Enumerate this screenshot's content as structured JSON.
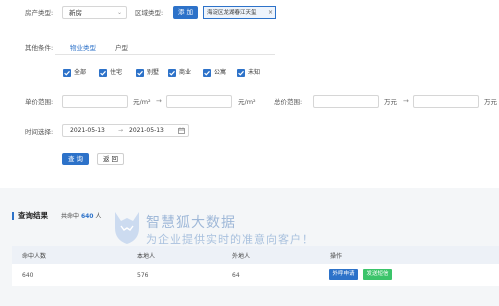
{
  "filters": {
    "property_type_label": "房产类型:",
    "property_type_value": "新房",
    "region_type_label": "区域类型:",
    "add_button": "添 加",
    "region_tag": "海淀区龙湖春江天玺",
    "region_tag_close": "×",
    "other_conditions_label": "其他条件:",
    "tabs": [
      "物业类型",
      "户型"
    ],
    "checkboxes": [
      "全部",
      "住宅",
      "别墅",
      "商业",
      "公寓",
      "未知"
    ],
    "unit_price_label": "单价范围:",
    "unit_price_unit": "元/m²",
    "unit_price_arrow": "→",
    "total_price_label": "总价范围:",
    "total_price_unit": "万元",
    "total_price_arrow": "→",
    "time_label": "时间选择:",
    "date_start": "2021-05-13",
    "date_arrow": "→",
    "date_end": "2021-05-13",
    "search_button": "查 询",
    "back_button": "返 回"
  },
  "results": {
    "title": "查询结果",
    "count_prefix": "共命中",
    "count": "640",
    "count_suffix": "人",
    "columns": [
      "命中人数",
      "本地人",
      "外地人",
      "操作"
    ],
    "row": {
      "hits": "640",
      "local": "576",
      "nonlocal": "64",
      "action_call": "外呼申请",
      "action_sms": "发送短信"
    }
  },
  "watermark": {
    "line1": "智慧狐大数据",
    "line2": "为企业提供实时的准意向客户！"
  },
  "colors": {
    "accent": "#2d72c9",
    "sms_button": "#3bc46a",
    "section_bg": "#f4f6f8"
  }
}
